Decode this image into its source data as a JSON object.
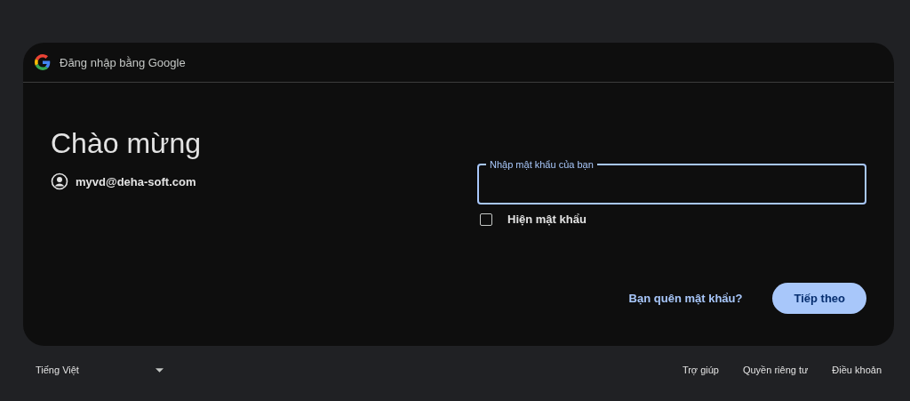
{
  "header": {
    "title": "Đăng nhập bằng Google"
  },
  "welcome": {
    "title": "Chào mừng",
    "account": "myvd@deha-soft.com"
  },
  "password_field": {
    "label": "Nhập mật khẩu của bạn",
    "focused": true
  },
  "show_password": {
    "label": "Hiện mật khẩu",
    "checked": false
  },
  "forgot_link": "Bạn quên mật khẩu?",
  "next_button": "Tiếp theo",
  "footer": {
    "language": "Tiếng Việt",
    "links": [
      "Trợ giúp",
      "Quyền riêng tư",
      "Điều khoản"
    ]
  }
}
